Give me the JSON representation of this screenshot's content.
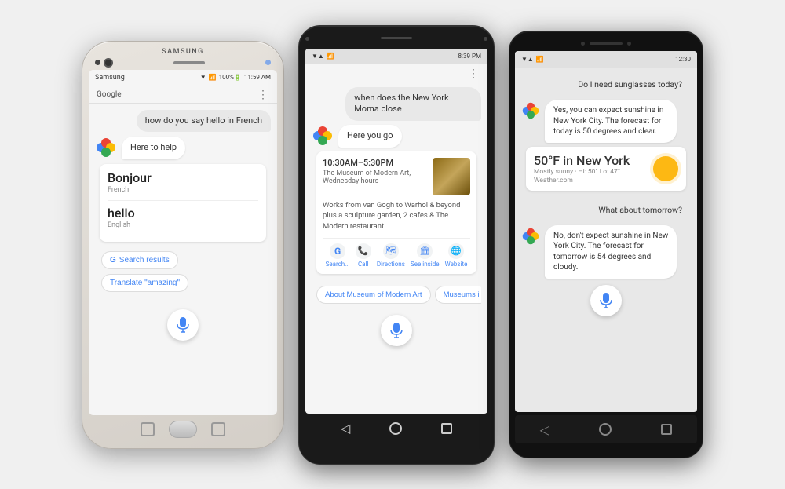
{
  "colors": {
    "blue": "#4285f4",
    "red": "#ea4335",
    "yellow": "#fbbc05",
    "green": "#34a853",
    "lightGray": "#f5f5f5",
    "white": "#ffffff",
    "textDark": "#333333",
    "textMed": "#666666",
    "textLight": "#888888"
  },
  "phone1": {
    "brand": "SAMSUNG",
    "statusLeft": "Samsung",
    "statusRight": "▼ 100% 🔋 11:59 AM",
    "appName": "Google",
    "userMessage": "how do you say hello in French",
    "assistantMessage": "Here to help",
    "translation": {
      "word1": "Bonjour",
      "lang1": "French",
      "word2": "hello",
      "lang2": "English"
    },
    "btn1": "Search results",
    "btn2": "Translate \"amazing\""
  },
  "phone2": {
    "statusRight": "▼ ▲ 8:39 PM",
    "userMessage": "when does the New York Moma close",
    "assistantMessage": "Here you go",
    "place": {
      "hours": "10:30AM–5:30PM",
      "name": "The Museum of Modern Art,",
      "nameDay": "Wednesday hours",
      "desc": "Works from van Gogh to Warhol & beyond plus a sculpture garden, 2 cafes & The Modern restaurant."
    },
    "actions": [
      "Search...",
      "Call",
      "Directions",
      "See inside",
      "Website"
    ],
    "suggest1": "About Museum of Modern Art",
    "suggest2": "Museums i"
  },
  "phone3": {
    "statusRight": "▼ ▲ 12:30",
    "msg1": "Do I need sunglasses today?",
    "reply1": "Yes, you can expect sunshine in New York City. The forecast for today is 50 degrees and clear.",
    "weather": {
      "temp": "50°F in New York",
      "conditions": "Mostly sunny · Hi: 50° Lo: 47°",
      "source": "Weather.com"
    },
    "msg2": "What about tomorrow?",
    "reply2": "No, don't expect sunshine in New York City. The forecast for tomorrow is 54 degrees and cloudy."
  }
}
